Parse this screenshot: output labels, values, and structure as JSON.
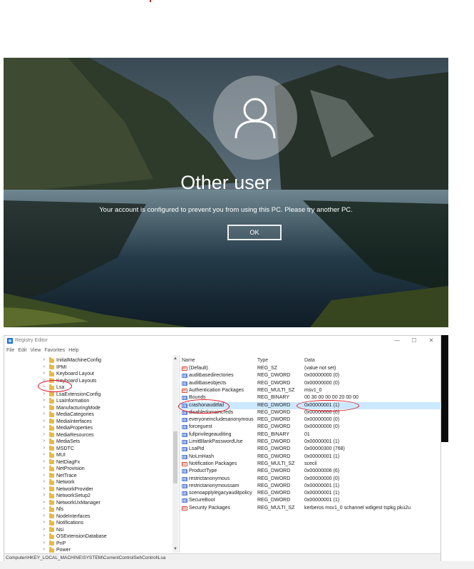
{
  "login": {
    "title": "Other user",
    "message": "Your account is configured to prevent you from using this PC. Please try another PC.",
    "ok_label": "OK"
  },
  "regedit": {
    "window_title": "Registry Editor",
    "menu": [
      "File",
      "Edit",
      "View",
      "Favorites",
      "Help"
    ],
    "win_minimize": "—",
    "win_maximize": "☐",
    "win_close": "✕",
    "tree_items": [
      "InitialMachineConfig",
      "IPMI",
      "Keyboard Layout",
      "Keyboard Layouts",
      "Lsa",
      "LsaExtensionConfig",
      "LsaInformation",
      "ManufacturingMode",
      "MediaCategories",
      "MediaInterfaces",
      "MediaProperties",
      "MediaResources",
      "MediaSets",
      "MSDTC",
      "MUI",
      "NetDiagFx",
      "NetProvision",
      "NetTrace",
      "Network",
      "NetworkProvider",
      "NetworkSetup2",
      "NetworkUxManager",
      "Nls",
      "NodeInterfaces",
      "Notifications",
      "Nsi",
      "OSExtensionDatabase",
      "PnP",
      "Power"
    ],
    "columns": {
      "name": "Name",
      "type": "Type",
      "data": "Data"
    },
    "values": [
      {
        "name": "(Default)",
        "type": "REG_SZ",
        "data": "(value not set)",
        "icon": "string"
      },
      {
        "name": "auditbasedirectories",
        "type": "REG_DWORD",
        "data": "0x00000000 (0)",
        "icon": "binary"
      },
      {
        "name": "auditbaseobjects",
        "type": "REG_DWORD",
        "data": "0x00000000 (0)",
        "icon": "binary"
      },
      {
        "name": "Authentication Packages",
        "type": "REG_MULTI_SZ",
        "data": "msv1_0",
        "icon": "string"
      },
      {
        "name": "Bounds",
        "type": "REG_BINARY",
        "data": "00 30 00 00 00 20 00 00",
        "icon": "binary"
      },
      {
        "name": "crashonauditfail",
        "type": "REG_DWORD",
        "data": "0x00000001 (1)",
        "icon": "binary"
      },
      {
        "name": "disabledomaincreds",
        "type": "REG_DWORD",
        "data": "0x00000000 (0)",
        "icon": "binary"
      },
      {
        "name": "everyoneincludesanonymous",
        "type": "REG_DWORD",
        "data": "0x00000000 (0)",
        "icon": "binary"
      },
      {
        "name": "forceguest",
        "type": "REG_DWORD",
        "data": "0x00000000 (0)",
        "icon": "binary"
      },
      {
        "name": "fullprivilegeauditing",
        "type": "REG_BINARY",
        "data": "01",
        "icon": "binary"
      },
      {
        "name": "LimitBlankPasswordUse",
        "type": "REG_DWORD",
        "data": "0x00000001 (1)",
        "icon": "binary"
      },
      {
        "name": "LsaPid",
        "type": "REG_DWORD",
        "data": "0x00000300 (768)",
        "icon": "binary"
      },
      {
        "name": "NoLmHash",
        "type": "REG_DWORD",
        "data": "0x00000001 (1)",
        "icon": "binary"
      },
      {
        "name": "Notification Packages",
        "type": "REG_MULTI_SZ",
        "data": "scecli",
        "icon": "string"
      },
      {
        "name": "ProductType",
        "type": "REG_DWORD",
        "data": "0x00000006 (6)",
        "icon": "binary"
      },
      {
        "name": "restrictanonymous",
        "type": "REG_DWORD",
        "data": "0x00000000 (0)",
        "icon": "binary"
      },
      {
        "name": "restrictanonymoussam",
        "type": "REG_DWORD",
        "data": "0x00000001 (1)",
        "icon": "binary"
      },
      {
        "name": "scenoapplylegacyauditpolicy",
        "type": "REG_DWORD",
        "data": "0x00000001 (1)",
        "icon": "binary"
      },
      {
        "name": "SecureBoot",
        "type": "REG_DWORD",
        "data": "0x00000001 (1)",
        "icon": "binary"
      },
      {
        "name": "Security Packages",
        "type": "REG_MULTI_SZ",
        "data": "kerberos msv1_0 schannel wdigest tspkg pku2u",
        "icon": "string"
      }
    ],
    "statusbar": "Computer\\HKEY_LOCAL_MACHINE\\SYSTEM\\CurrentControlSet\\Control\\Lsa"
  }
}
